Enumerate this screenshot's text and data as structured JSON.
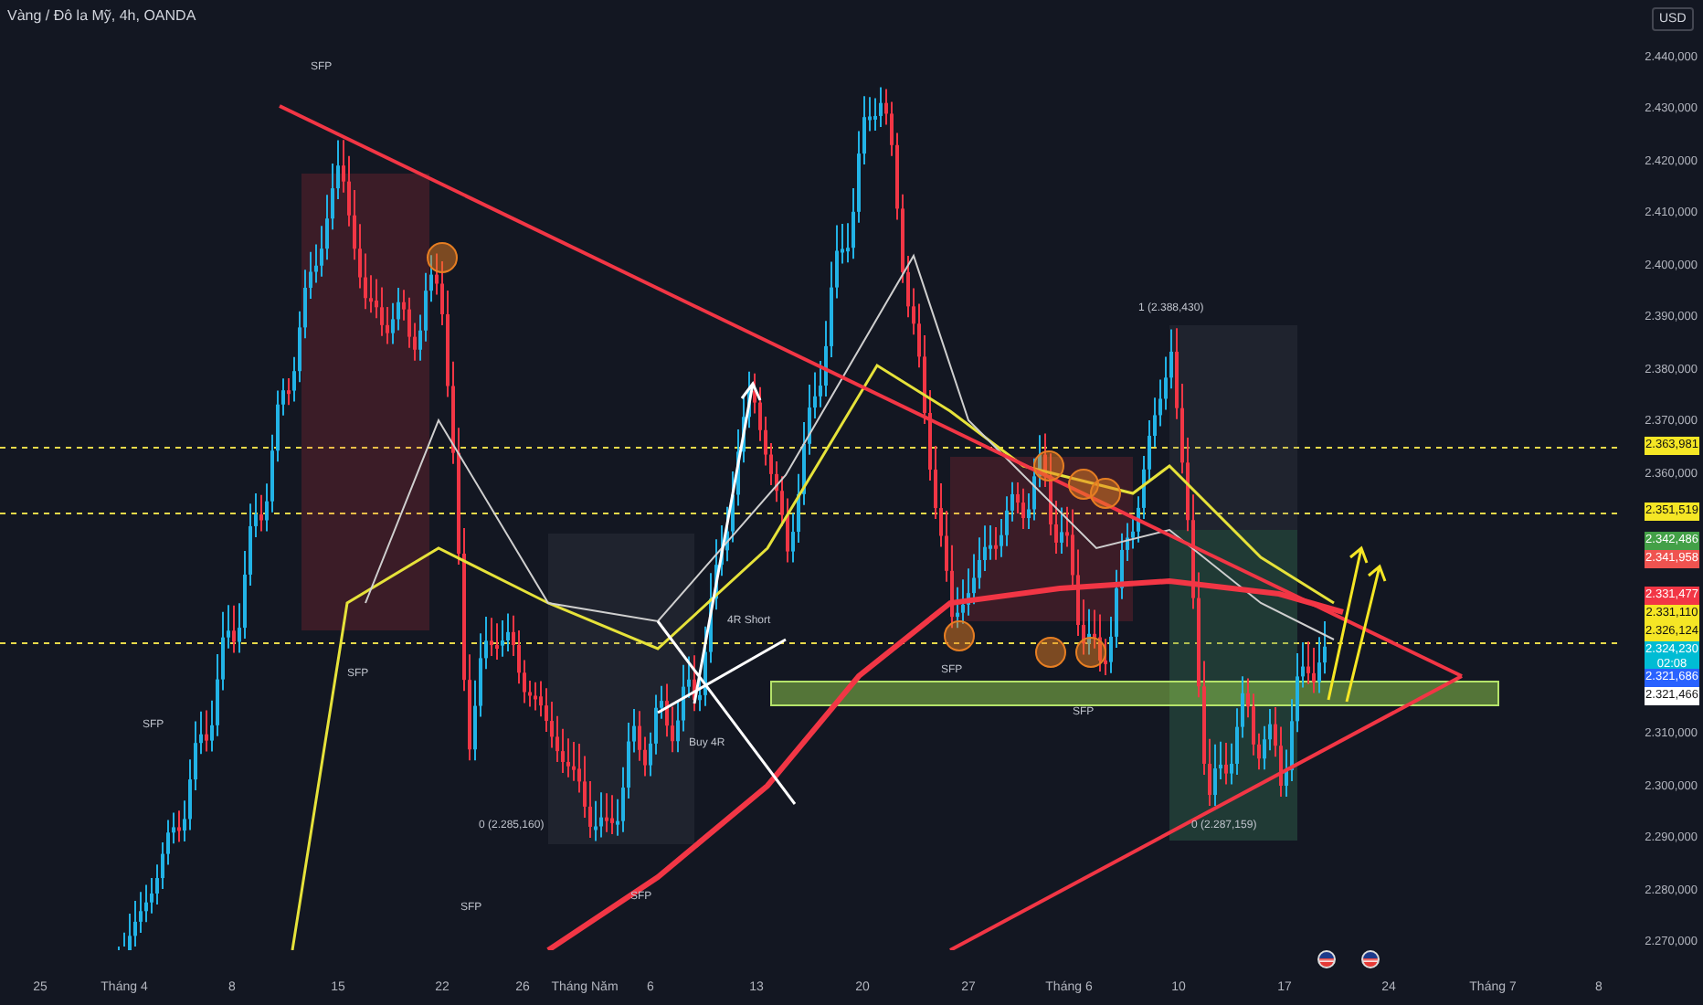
{
  "header": {
    "title": "Vàng / Đô la Mỹ, 4h, OANDA",
    "currency": "USD"
  },
  "price_ticks": [
    "2.440,000",
    "2.430,000",
    "2.420,000",
    "2.410,000",
    "2.400,000",
    "2.390,000",
    "2.380,000",
    "2.370,000",
    "2.360,000",
    "2.310,000",
    "2.300,000",
    "2.290,000",
    "2.280,000",
    "2.270,000"
  ],
  "price_badges": [
    {
      "text": "2.363,981",
      "color": "#f5e625"
    },
    {
      "text": "2.351,519",
      "color": "#f5e625"
    },
    {
      "text": "2.342,486",
      "color": "#43a047"
    },
    {
      "text": "2.341,958",
      "color": "#ef5350"
    },
    {
      "text": "2.331,477",
      "color": "#f23645"
    },
    {
      "text": "2.331,110",
      "color": "#f5e625"
    },
    {
      "text": "2.326,124",
      "color": "#f5e625"
    },
    {
      "text": "2.324,230",
      "sub": "02:08",
      "color": "#00bcd4"
    },
    {
      "text": "2.321,686",
      "color": "#2962ff"
    },
    {
      "text": "2.321,466",
      "color": "#ffffff"
    }
  ],
  "date_ticks": [
    "25",
    "Tháng 4",
    "8",
    "15",
    "22",
    "26",
    "Tháng Năm",
    "6",
    "13",
    "20",
    "27",
    "Tháng 6",
    "10",
    "17",
    "24",
    "Tháng 7",
    "8"
  ],
  "annotations": [
    "SFP",
    "SFP",
    "SFP",
    "SFP",
    "SFP",
    "SFP",
    "SFP",
    "1 (2.388,430)",
    "0 (2.287,159)",
    "0 (2.285,160)",
    "4R Short",
    "Buy 4R"
  ]
}
